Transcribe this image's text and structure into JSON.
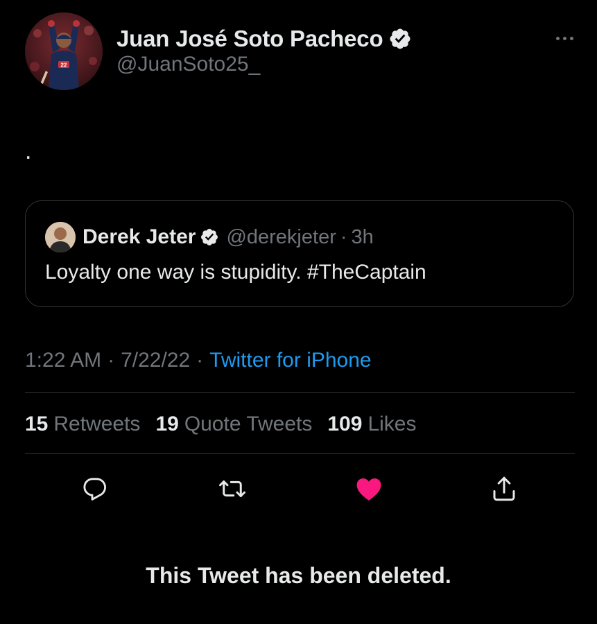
{
  "author": {
    "name": "Juan José Soto Pacheco",
    "handle": "@JuanSoto25_"
  },
  "tweet": {
    "text": "."
  },
  "quoted_tweet": {
    "name": "Derek Jeter",
    "handle": "@derekjeter",
    "separator": "·",
    "time": "3h",
    "text": "Loyalty one way is stupidity. #TheCaptain"
  },
  "meta": {
    "time": "1:22 AM",
    "separator_1": "·",
    "date": "7/22/22",
    "separator_2": "·",
    "source": "Twitter for iPhone"
  },
  "stats": {
    "retweets_count": "15",
    "retweets_label": "Retweets",
    "quotes_count": "19",
    "quotes_label": "Quote Tweets",
    "likes_count": "109",
    "likes_label": "Likes"
  },
  "actions": [
    "reply-icon",
    "retweet-icon",
    "like-icon",
    "share-icon"
  ],
  "colors": {
    "background": "#000000",
    "text_primary": "#e7e9ea",
    "text_secondary": "#71767b",
    "link": "#1d9bf0",
    "like": "#f91880",
    "border": "#2f3336"
  },
  "notice": "This Tweet has been deleted."
}
